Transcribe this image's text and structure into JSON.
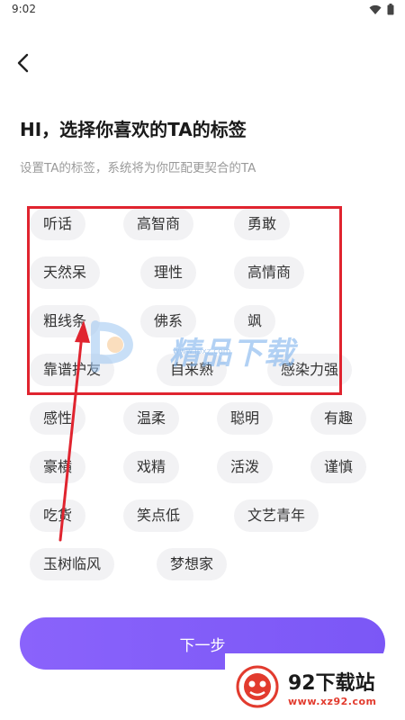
{
  "status_bar": {
    "time": "9:02"
  },
  "header": {
    "title": "HI，选择你喜欢的TA的标签",
    "subtitle": "设置TA的标签，系统将为你匹配更契合的TA"
  },
  "tags": [
    "听话",
    "高智商",
    "勇敢",
    "天然呆",
    "理性",
    "高情商",
    "粗线条",
    "佛系",
    "飒",
    "靠谱护友",
    "自来熟",
    "感染力强",
    "感性",
    "温柔",
    "聪明",
    "有趣",
    "豪横",
    "戏精",
    "活泼",
    "谨慎",
    "吃货",
    "笑点低",
    "文艺青年",
    "玉树临风",
    "梦想家"
  ],
  "next_button": {
    "label": "下一步"
  },
  "watermark": {
    "text": "精品下载",
    "url": "www.jpxz.com"
  },
  "corner_badge": {
    "title": "92下载站",
    "url": "www.xz92.com"
  },
  "colors": {
    "accent": "#7b57f6",
    "tag_bg": "#f2f2f4",
    "annotation_red": "#e0242f"
  }
}
